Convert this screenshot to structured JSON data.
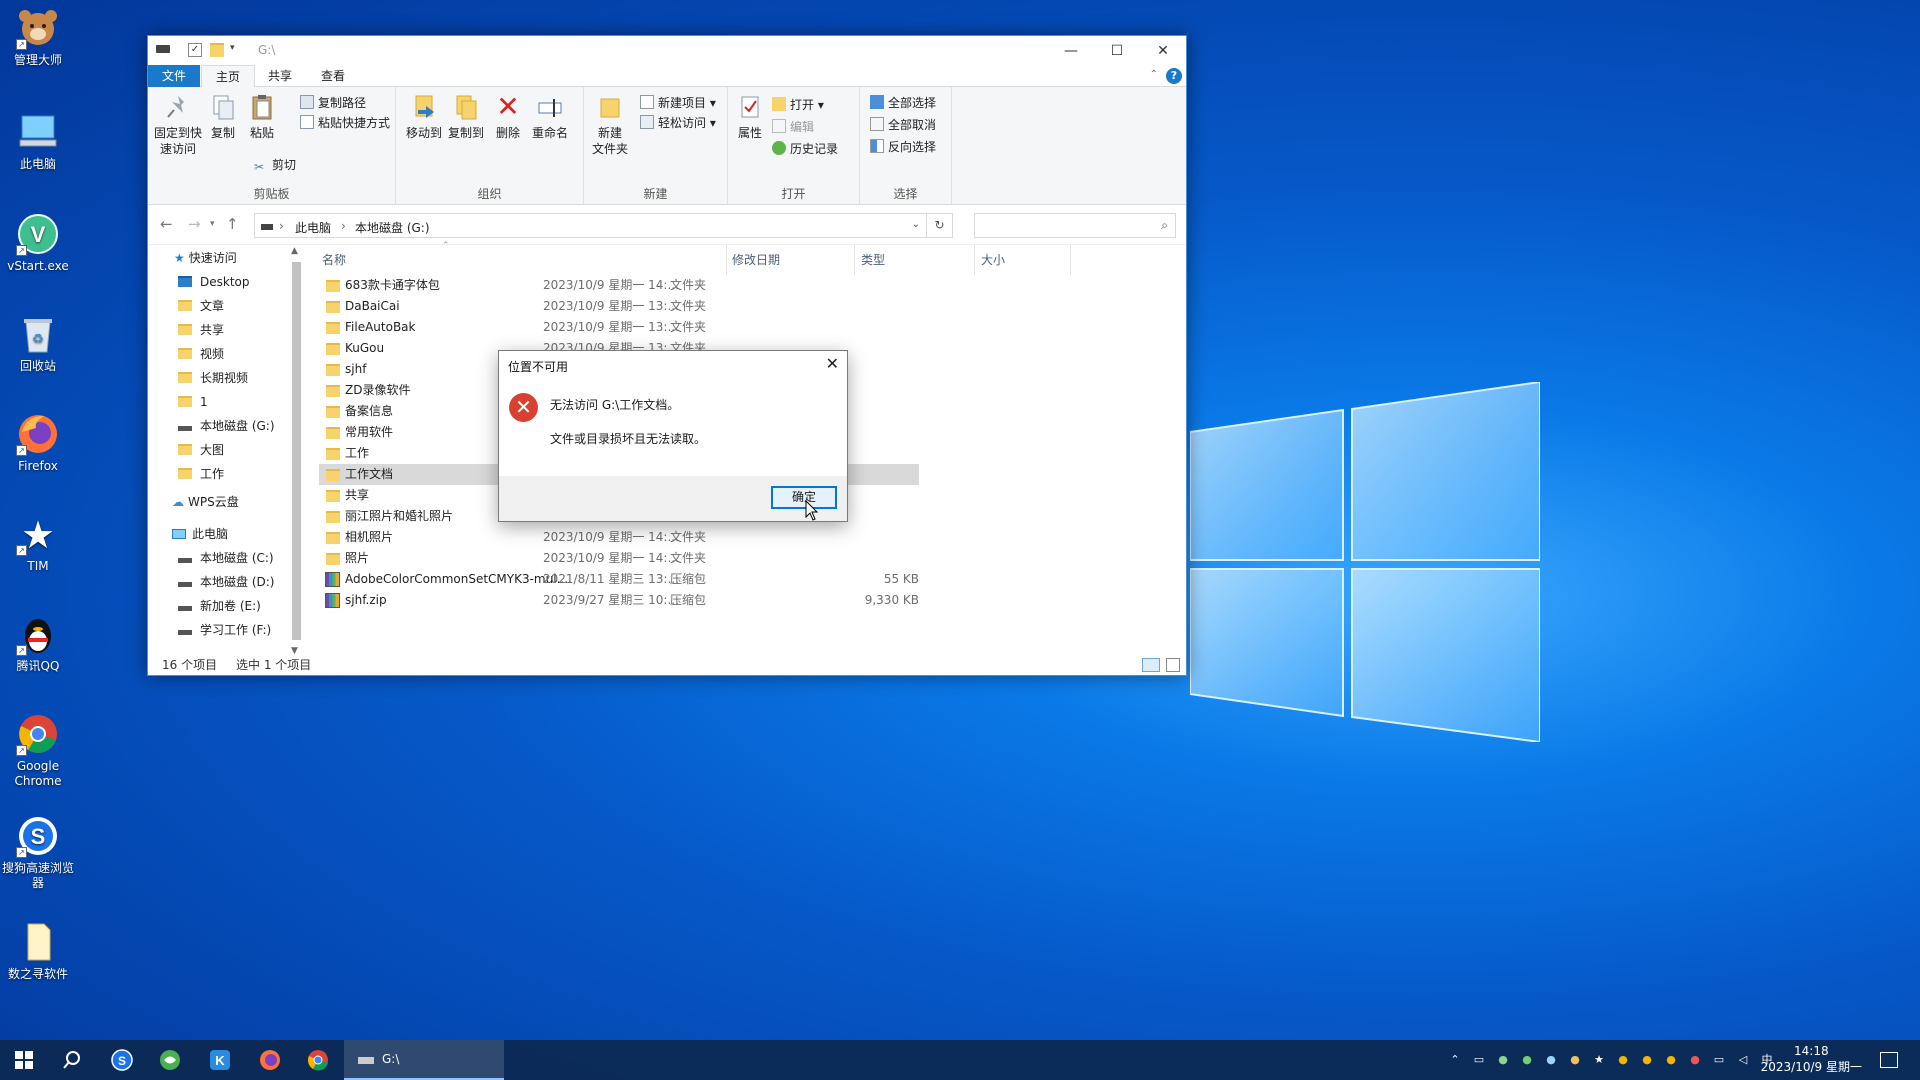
{
  "desktop": {
    "icons": [
      {
        "label": "管理大师",
        "icon": "bear-mascot-icon"
      },
      {
        "label": "此电脑",
        "icon": "computer-icon"
      },
      {
        "label": "vStart.exe",
        "icon": "vstart-icon"
      },
      {
        "label": "回收站",
        "icon": "recycle-bin-icon"
      },
      {
        "label": "Firefox",
        "icon": "firefox-icon"
      },
      {
        "label": "TIM",
        "icon": "tim-icon"
      },
      {
        "label": "腾讯QQ",
        "icon": "qq-penguin-icon"
      },
      {
        "label": "Google Chrome",
        "icon": "chrome-icon"
      },
      {
        "label": "搜狗高速浏览器",
        "icon": "sogou-browser-icon"
      },
      {
        "label": "数之寻软件",
        "icon": "file-icon"
      }
    ]
  },
  "explorer": {
    "title": "G:\\",
    "tabs": {
      "file": "文件",
      "home": "主页",
      "share": "共享",
      "view": "查看"
    },
    "ribbon": {
      "clipboard": {
        "group": "剪贴板",
        "pin": "固定到快\n速访问",
        "copy": "复制",
        "paste": "粘贴",
        "copy_path": "复制路径",
        "paste_shortcut": "粘贴快捷方式",
        "cut": "剪切"
      },
      "organize": {
        "group": "组织",
        "move_to": "移动到",
        "copy_to": "复制到",
        "delete": "删除",
        "rename": "重命名"
      },
      "new": {
        "group": "新建",
        "new_folder": "新建\n文件夹",
        "new_item": "新建项目",
        "easy_access": "轻松访问"
      },
      "open": {
        "group": "打开",
        "properties": "属性",
        "open": "打开",
        "edit": "编辑",
        "history": "历史记录"
      },
      "select": {
        "group": "选择",
        "select_all": "全部选择",
        "select_none": "全部取消",
        "invert": "反向选择"
      }
    },
    "address": {
      "crumb1": "此电脑",
      "crumb2": "本地磁盘 (G:)"
    },
    "nav_pane": [
      {
        "label": "快速访问",
        "type": "star"
      },
      {
        "label": "Desktop",
        "type": "desktop",
        "pinned": true
      },
      {
        "label": "文章",
        "type": "folder",
        "pinned": true
      },
      {
        "label": "共享",
        "type": "folder",
        "pinned": true
      },
      {
        "label": "视频",
        "type": "folder",
        "pinned": true
      },
      {
        "label": "长期视频",
        "type": "folder",
        "pinned": true
      },
      {
        "label": "1",
        "type": "folder"
      },
      {
        "label": "本地磁盘 (G:)",
        "type": "drive"
      },
      {
        "label": "大图",
        "type": "folder"
      },
      {
        "label": "工作",
        "type": "folder"
      },
      {
        "label": "WPS云盘",
        "type": "cloud"
      },
      {
        "label": "此电脑",
        "type": "pc"
      },
      {
        "label": "本地磁盘 (C:)",
        "type": "drive"
      },
      {
        "label": "本地磁盘 (D:)",
        "type": "drive"
      },
      {
        "label": "新加卷 (E:)",
        "type": "drive"
      },
      {
        "label": "学习工作 (F:)",
        "type": "drive"
      }
    ],
    "columns": {
      "name": "名称",
      "date": "修改日期",
      "type": "类型",
      "size": "大小"
    },
    "files": [
      {
        "name": "683款卡通字体包",
        "date": "2023/10/9 星期一 14:...",
        "type": "文件夹",
        "size": "",
        "kind": "folder"
      },
      {
        "name": "DaBaiCai",
        "date": "2023/10/9 星期一 13:...",
        "type": "文件夹",
        "size": "",
        "kind": "folder"
      },
      {
        "name": "FileAutoBak",
        "date": "2023/10/9 星期一 13:...",
        "type": "文件夹",
        "size": "",
        "kind": "folder"
      },
      {
        "name": "KuGou",
        "date": "2023/10/9 星期一 13:...",
        "type": "文件夹",
        "size": "",
        "kind": "folder"
      },
      {
        "name": "sjhf",
        "date": "",
        "type": "",
        "size": "",
        "kind": "folder"
      },
      {
        "name": "ZD录像软件",
        "date": "",
        "type": "",
        "size": "",
        "kind": "folder"
      },
      {
        "name": "备案信息",
        "date": "",
        "type": "",
        "size": "",
        "kind": "folder"
      },
      {
        "name": "常用软件",
        "date": "",
        "type": "",
        "size": "",
        "kind": "folder"
      },
      {
        "name": "工作",
        "date": "",
        "type": "",
        "size": "",
        "kind": "folder"
      },
      {
        "name": "工作文档",
        "date": "",
        "type": "",
        "size": "",
        "kind": "folder",
        "selected": true
      },
      {
        "name": "共享",
        "date": "",
        "type": "",
        "size": "",
        "kind": "folder"
      },
      {
        "name": "丽江照片和婚礼照片",
        "date": "",
        "type": "",
        "size": "",
        "kind": "folder"
      },
      {
        "name": "相机照片",
        "date": "2023/10/9 星期一 14:...",
        "type": "文件夹",
        "size": "",
        "kind": "folder"
      },
      {
        "name": "照片",
        "date": "2023/10/9 星期一 14:...",
        "type": "文件夹",
        "size": "",
        "kind": "folder"
      },
      {
        "name": "AdobeColorCommonSetCMYK3-mul....",
        "date": "2021/8/11 星期三 13:...",
        "type": "压缩包",
        "size": "55 KB",
        "kind": "zip"
      },
      {
        "name": "sjhf.zip",
        "date": "2023/9/27 星期三 10:...",
        "type": "压缩包",
        "size": "9,330 KB",
        "kind": "zip"
      }
    ],
    "status": {
      "count": "16 个项目",
      "selected": "选中 1 个项目"
    }
  },
  "dialog": {
    "title": "位置不可用",
    "message1": "无法访问 G:\\工作文档。",
    "message2": "文件或目录损坏且无法读取。",
    "ok": "确定"
  },
  "taskbar": {
    "active_window": "G:\\",
    "time": "14:18",
    "date": "2023/10/9 星期一",
    "ime": "中"
  },
  "colors": {
    "accent": "#1979ca",
    "desktop": "#0659c9",
    "selection": "#d9d9d9",
    "error": "#d8412f"
  }
}
